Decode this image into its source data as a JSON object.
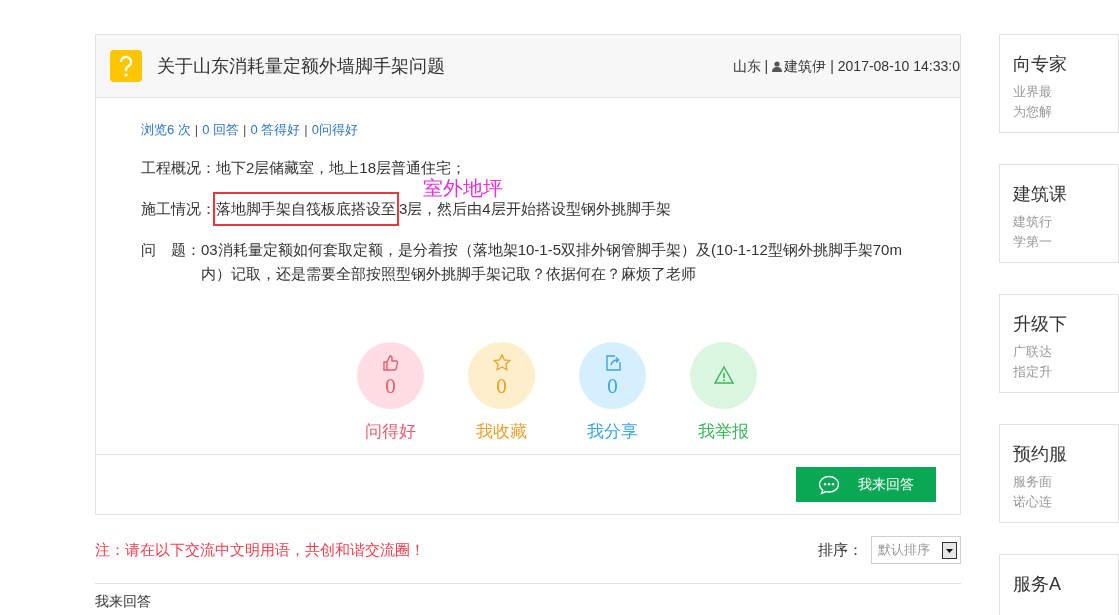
{
  "question": {
    "title": "关于山东消耗量定额外墙脚手架问题",
    "region": "山东",
    "author": "建筑伊",
    "time": "2017-08-10 14:33:0",
    "separator": "|",
    "stats": [
      "浏览6 次",
      "0 回答",
      "0 答得好",
      "0问得好"
    ],
    "paragraphs": [
      {
        "label": "工程概况：",
        "text": "地下2层储藏室，地上18层普通住宅；"
      },
      {
        "label": "施工情况：",
        "boxed": "落地脚手架自筏板底搭设至",
        "text": "3层，然后由4层开始搭设型钢外挑脚手架",
        "note": "室外地坪"
      },
      {
        "label": "问　题：",
        "text": "03消耗量定额如何套取定额，是分着按（落地架10-1-5双排外钢管脚手架）及(10-1-12型钢外挑脚手架70m内）记取，还是需要全部按照型钢外挑脚手架记取？依据何在？麻烦了老师"
      }
    ],
    "actions": [
      {
        "kind": "like",
        "count": "0",
        "label": "问得好"
      },
      {
        "kind": "collect",
        "count": "0",
        "label": "我收藏"
      },
      {
        "kind": "share",
        "count": "0",
        "label": "我分享"
      },
      {
        "kind": "report",
        "label": "我举报"
      }
    ],
    "answer_button": "我来回答"
  },
  "notice": "注：请在以下交流中文明用语，共创和谐交流圈！",
  "sort": {
    "label": "排序：",
    "value": "默认排序"
  },
  "answer_heading": "我来回答",
  "sidebar": [
    {
      "title": "向专家",
      "lines": [
        "业界最",
        "为您解"
      ]
    },
    {
      "title": "建筑课",
      "lines": [
        "建筑行",
        "学第一"
      ]
    },
    {
      "title": "升级下",
      "lines": [
        "广联达",
        "指定升"
      ]
    },
    {
      "title": "预约服",
      "lines": [
        "服务面",
        "诺心连"
      ]
    },
    {
      "title": "服务A"
    }
  ]
}
